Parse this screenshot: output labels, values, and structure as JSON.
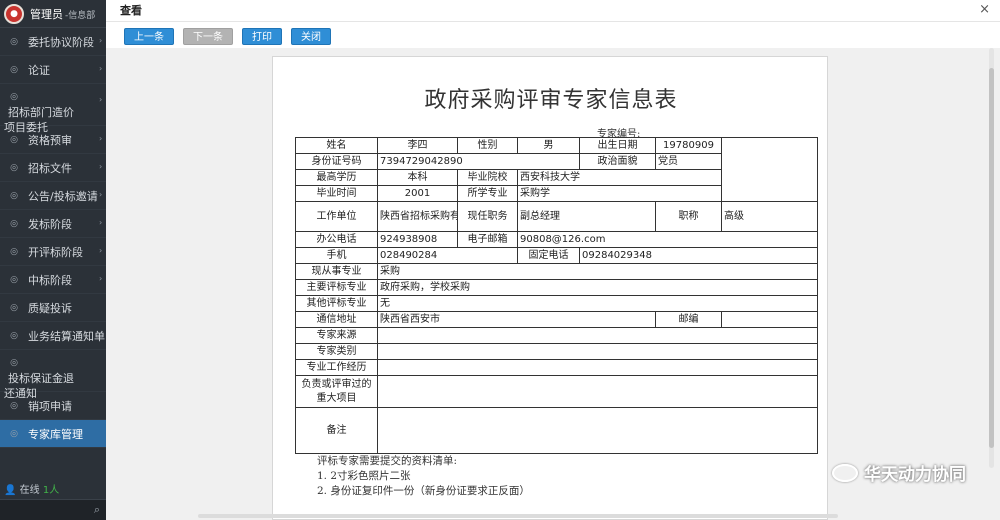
{
  "sidebar": {
    "user": "管理员",
    "dept": "-信息部",
    "items": [
      {
        "label": "委托协议阶段",
        "arrow": true
      },
      {
        "label": "论证",
        "arrow": true
      },
      {
        "label": "招标部门造价",
        "cont": "项目委托",
        "arrow": true
      },
      {
        "label": "资格预审",
        "arrow": true
      },
      {
        "label": "招标文件",
        "arrow": true
      },
      {
        "label": "公告/投标邀请",
        "arrow": true
      },
      {
        "label": "发标阶段",
        "arrow": true
      },
      {
        "label": "开评标阶段",
        "arrow": true
      },
      {
        "label": "中标阶段",
        "arrow": true
      },
      {
        "label": "质疑投诉",
        "arrow": false
      },
      {
        "label": "业务结算通知单",
        "arrow": false
      },
      {
        "label": "投标保证金退",
        "cont": "还通知",
        "arrow": false
      },
      {
        "label": "销项申请",
        "arrow": false
      },
      {
        "label": "专家库管理",
        "arrow": false,
        "active": true
      }
    ],
    "online": "在线",
    "online_count": "1人"
  },
  "dialog": {
    "title": "查看",
    "close": "×",
    "buttons": {
      "prev": "上一条",
      "next": "下一条",
      "print": "打印",
      "close": "关闭"
    }
  },
  "doc": {
    "title": "政府采购评审专家信息表",
    "expert_no_label": "专家编号:",
    "labels": {
      "name": "姓名",
      "gender": "性别",
      "birth": "出生日期",
      "id": "身份证号码",
      "politics": "政治面貌",
      "edu": "最高学历",
      "school": "毕业院校",
      "grad_time": "毕业时间",
      "major": "所学专业",
      "employer": "工作单位",
      "position": "现任职务",
      "title": "职称",
      "office_phone": "办公电话",
      "email": "电子邮箱",
      "mobile": "手机",
      "landline": "固定电话",
      "current_major": "现从事专业",
      "main_major": "主要评标专业",
      "other_major": "其他评标专业",
      "address": "通信地址",
      "postcode": "邮编",
      "source": "专家来源",
      "category": "专家类别",
      "experience": "专业工作经历",
      "projects_1": "负责或评审过的",
      "projects_2": "重大项目",
      "remarks": "备注"
    },
    "values": {
      "name": "李四",
      "gender": "男",
      "birth": "19780909",
      "id": "7394729042890",
      "politics": "党员",
      "edu": "本科",
      "school": "西安科技大学",
      "grad_time": "2001",
      "major": "采购学",
      "employer": "陕西省招标采购有限责任公司",
      "position": "副总经理",
      "title": "高级",
      "office_phone": "924938908",
      "email": "90808@126.com",
      "mobile": "028490284",
      "landline": "09284029348",
      "current_major": "采购",
      "main_major": "政府采购，学校采购",
      "other_major": "无",
      "address": "陕西省西安市"
    },
    "notes": [
      "评标专家需要提交的资料清单:",
      "1. 2寸彩色照片二张",
      "2. 身份证复印件一份（新身份证要求正反面）"
    ]
  },
  "watermark": "华天动力协同"
}
